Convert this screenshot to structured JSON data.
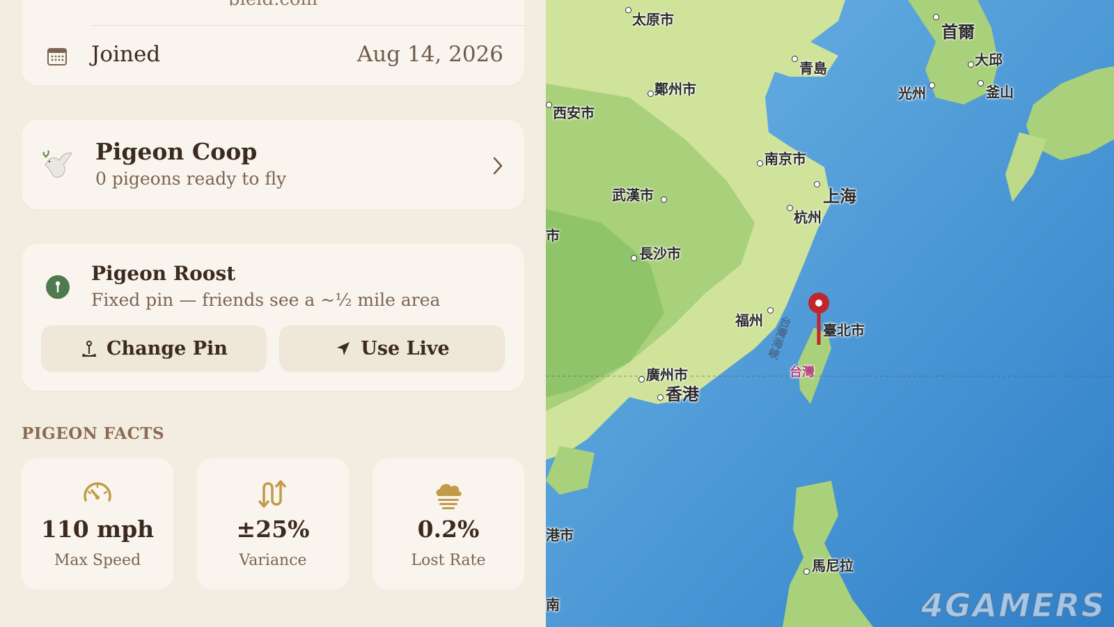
{
  "profile": {
    "email_partial": "pield.com",
    "joined_label": "Joined",
    "joined_value": "Aug 14, 2026"
  },
  "coop": {
    "title": "Pigeon Coop",
    "subtitle": "0 pigeons ready to fly"
  },
  "roost": {
    "title": "Pigeon Roost",
    "subtitle": "Fixed pin — friends see a ~½ mile area",
    "change_pin_label": "Change Pin",
    "use_live_label": "Use Live"
  },
  "facts": {
    "heading": "PIGEON FACTS",
    "items": [
      {
        "value": "110 mph",
        "label": "Max Speed",
        "icon": "speedometer-icon"
      },
      {
        "value": "±25%",
        "label": "Variance",
        "icon": "arrows-up-down-icon"
      },
      {
        "value": "0.2%",
        "label": "Lost Rate",
        "icon": "cloud-fog-icon"
      }
    ]
  },
  "map": {
    "cities": [
      "太原市",
      "首爾",
      "青島",
      "大邱",
      "鄭州市",
      "光州",
      "釜山",
      "西安市",
      "南京市",
      "上海",
      "武漢市",
      "杭州",
      "市",
      "長沙市",
      "福州",
      "臺北市",
      "台灣",
      "廣州市",
      "香港",
      "港市",
      "馬尼拉",
      "南"
    ],
    "strait_label": "台灣海峽",
    "watermark": "4GAMERS",
    "pin_color": "#c0262d"
  }
}
